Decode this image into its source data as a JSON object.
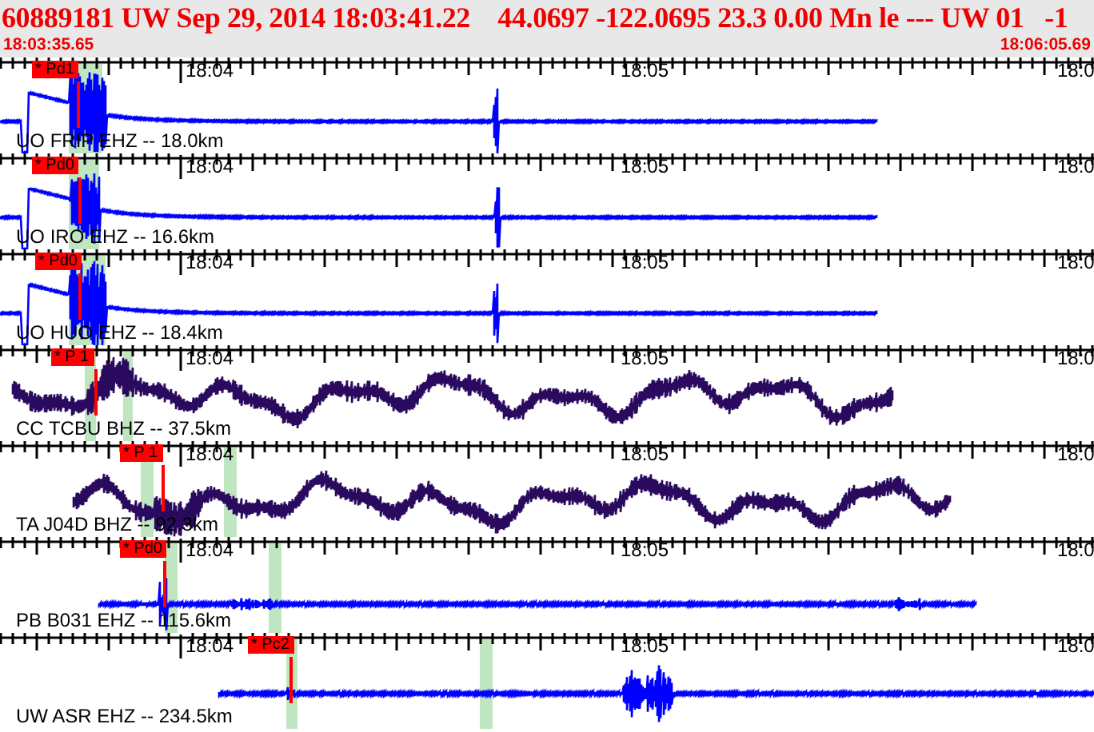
{
  "header": {
    "event_summary": "60889181 UW Sep 29, 2014 18:03:41.22    44.0697 -122.0695 23.3 0.00 Mn le --- UW 01   -1",
    "start_time": "18:03:35.65",
    "end_time": "18:06:05.69"
  },
  "traces": [
    {
      "label": "UO FRIP EHZ -- 18.0km",
      "color": "#0000ff",
      "pick": "* Pd1",
      "time_labels": [
        "18:04",
        "18:05",
        "18:0"
      ]
    },
    {
      "label": "UO IRO EHZ -- 16.6km",
      "color": "#0000ff",
      "pick": "* Pd0",
      "time_labels": [
        "18:04",
        "18:05",
        "18:0"
      ]
    },
    {
      "label": "UO HUO EHZ -- 18.4km",
      "color": "#0000ff",
      "pick": "* Pd0",
      "time_labels": [
        "18:04",
        "18:05",
        "18:0"
      ]
    },
    {
      "label": "CC TCBU BHZ -- 37.5km",
      "color": "#2a0a5e",
      "pick": "* P 1",
      "time_labels": [
        "18:04",
        "18:05",
        "18:0"
      ]
    },
    {
      "label": "TA J04D BHZ -- 92.3km",
      "color": "#2a0a5e",
      "pick": "* P 1",
      "time_labels": [
        "18:04",
        "18:05",
        "18:0"
      ]
    },
    {
      "label": "PB B031 EHZ -- 115.6km",
      "color": "#0000ff",
      "pick": "* Pd0",
      "time_labels": [
        "18:04",
        "18:05",
        "18:0"
      ]
    },
    {
      "label": "UW ASR EHZ -- 234.5km",
      "color": "#0000ff",
      "pick": "* Pc2",
      "time_labels": [
        "18:04",
        "18:05",
        "18:0"
      ]
    }
  ]
}
